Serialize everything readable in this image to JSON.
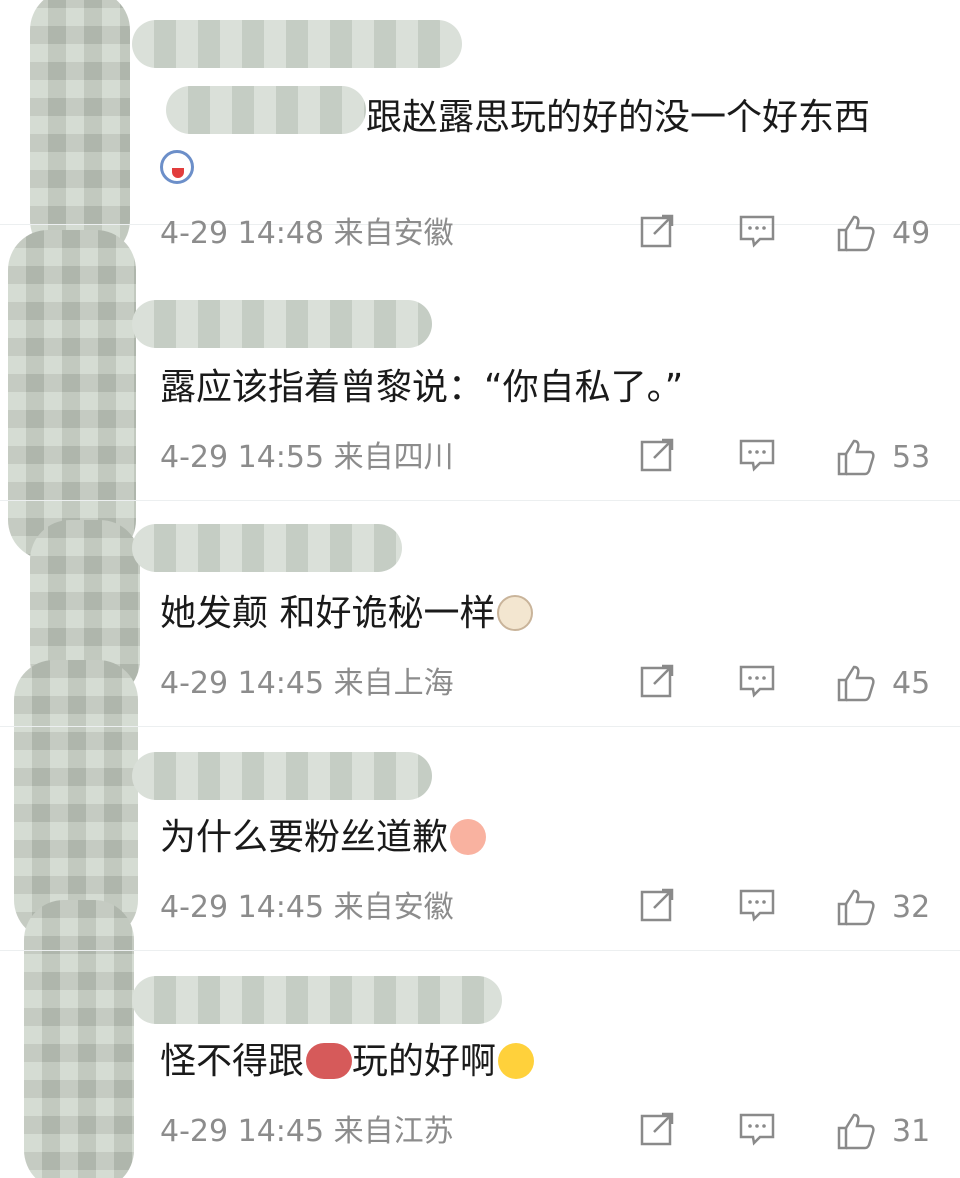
{
  "comments": [
    {
      "text": "跟赵露思玩的好的没一个好东西",
      "sticker": "panda-sticker-icon",
      "timestamp": "4-29 14:48",
      "location": "来自安徽",
      "likes": "49"
    },
    {
      "text": "露应该指着曾黎说：“你自私了。”",
      "timestamp": "4-29 14:55",
      "location": "来自四川",
      "likes": "53"
    },
    {
      "text": "她发颠 和好诡秘一样",
      "emoji": "tea-cup-emoji-icon",
      "timestamp": "4-29 14:45",
      "location": "来自上海",
      "likes": "45"
    },
    {
      "text": "为什么要粉丝道歉",
      "emoji": "face-bun-emoji-icon",
      "timestamp": "4-29 14:45",
      "location": "来自安徽",
      "likes": "32"
    },
    {
      "text_before": "怪不得跟",
      "inline_emoji": "meat-emoji-icon",
      "text_after": "玩的好啊",
      "emoji": "laughing-tears-emoji-icon",
      "timestamp": "4-29 14:45",
      "location": "来自江苏",
      "likes": "31"
    }
  ],
  "colors": {
    "meta_text": "#8c8c8c",
    "body_text": "#1a1a1a",
    "divider": "#eceff0",
    "mosaic": "#c3ccc0"
  },
  "icons": [
    "share-icon",
    "comment-icon",
    "like-icon"
  ]
}
